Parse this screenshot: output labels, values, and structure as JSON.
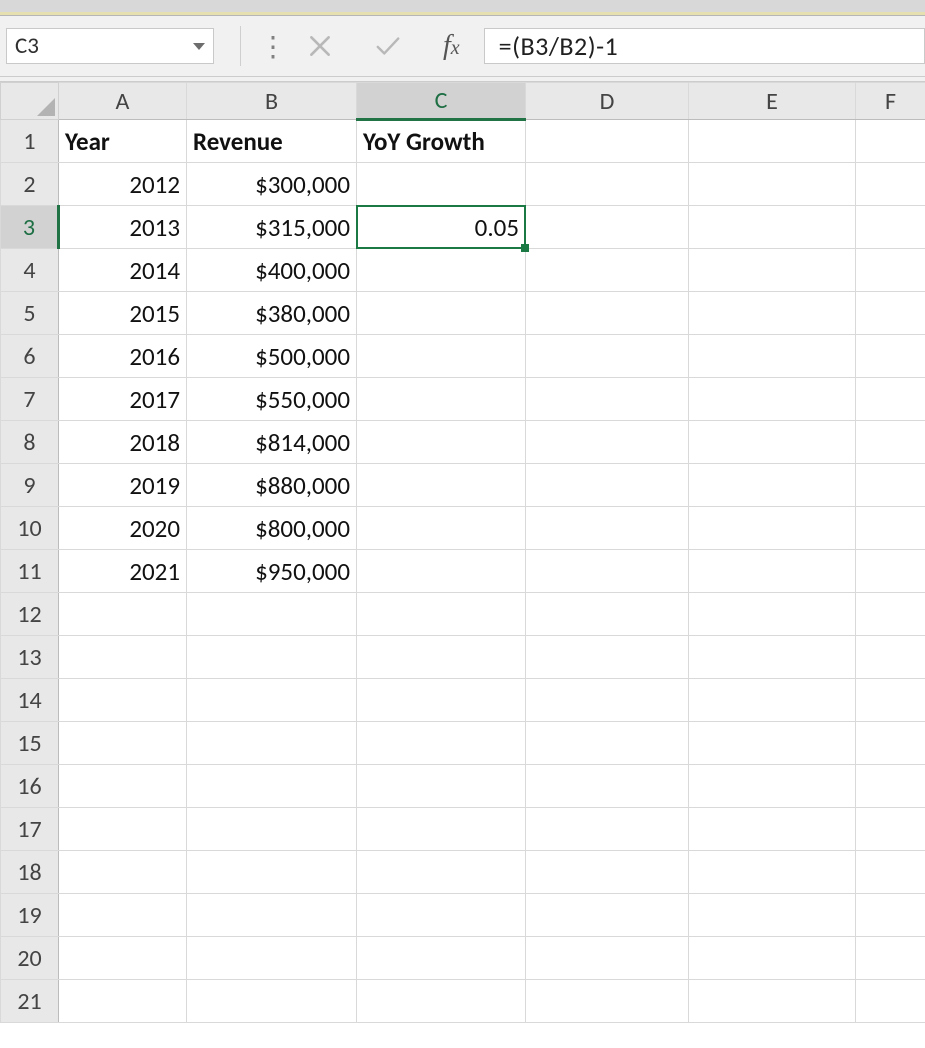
{
  "formula_bar": {
    "cell_ref": "C3",
    "formula": "=(B3/B2)-1"
  },
  "columns": [
    "A",
    "B",
    "C",
    "D",
    "E",
    "F"
  ],
  "selection": {
    "row": 3,
    "col": "C"
  },
  "rows": [
    {
      "n": 1,
      "A": {
        "v": "Year",
        "align": "l",
        "bold": true
      },
      "B": {
        "v": "Revenue",
        "align": "l",
        "bold": true
      },
      "C": {
        "v": "YoY Growth",
        "align": "l",
        "bold": true
      }
    },
    {
      "n": 2,
      "A": {
        "v": "2012",
        "align": "r"
      },
      "B": {
        "v": "$300,000",
        "align": "r"
      }
    },
    {
      "n": 3,
      "A": {
        "v": "2013",
        "align": "r"
      },
      "B": {
        "v": "$315,000",
        "align": "r"
      },
      "C": {
        "v": "0.05",
        "align": "r"
      }
    },
    {
      "n": 4,
      "A": {
        "v": "2014",
        "align": "r"
      },
      "B": {
        "v": "$400,000",
        "align": "r"
      }
    },
    {
      "n": 5,
      "A": {
        "v": "2015",
        "align": "r"
      },
      "B": {
        "v": "$380,000",
        "align": "r"
      }
    },
    {
      "n": 6,
      "A": {
        "v": "2016",
        "align": "r"
      },
      "B": {
        "v": "$500,000",
        "align": "r"
      }
    },
    {
      "n": 7,
      "A": {
        "v": "2017",
        "align": "r"
      },
      "B": {
        "v": "$550,000",
        "align": "r"
      }
    },
    {
      "n": 8,
      "A": {
        "v": "2018",
        "align": "r"
      },
      "B": {
        "v": "$814,000",
        "align": "r"
      }
    },
    {
      "n": 9,
      "A": {
        "v": "2019",
        "align": "r"
      },
      "B": {
        "v": "$880,000",
        "align": "r"
      }
    },
    {
      "n": 10,
      "A": {
        "v": "2020",
        "align": "r"
      },
      "B": {
        "v": "$800,000",
        "align": "r"
      }
    },
    {
      "n": 11,
      "A": {
        "v": "2021",
        "align": "r"
      },
      "B": {
        "v": "$950,000",
        "align": "r"
      }
    },
    {
      "n": 12
    },
    {
      "n": 13
    },
    {
      "n": 14
    },
    {
      "n": 15
    },
    {
      "n": 16
    },
    {
      "n": 17
    },
    {
      "n": 18
    },
    {
      "n": 19
    },
    {
      "n": 20
    },
    {
      "n": 21
    }
  ],
  "chart_data": {
    "type": "table",
    "title": "Revenue by Year",
    "columns": [
      "Year",
      "Revenue",
      "YoY Growth"
    ],
    "records": [
      {
        "Year": 2012,
        "Revenue": 300000,
        "YoY Growth": null
      },
      {
        "Year": 2013,
        "Revenue": 315000,
        "YoY Growth": 0.05
      },
      {
        "Year": 2014,
        "Revenue": 400000,
        "YoY Growth": null
      },
      {
        "Year": 2015,
        "Revenue": 380000,
        "YoY Growth": null
      },
      {
        "Year": 2016,
        "Revenue": 500000,
        "YoY Growth": null
      },
      {
        "Year": 2017,
        "Revenue": 550000,
        "YoY Growth": null
      },
      {
        "Year": 2018,
        "Revenue": 814000,
        "YoY Growth": null
      },
      {
        "Year": 2019,
        "Revenue": 880000,
        "YoY Growth": null
      },
      {
        "Year": 2020,
        "Revenue": 800000,
        "YoY Growth": null
      },
      {
        "Year": 2021,
        "Revenue": 950000,
        "YoY Growth": null
      }
    ]
  }
}
